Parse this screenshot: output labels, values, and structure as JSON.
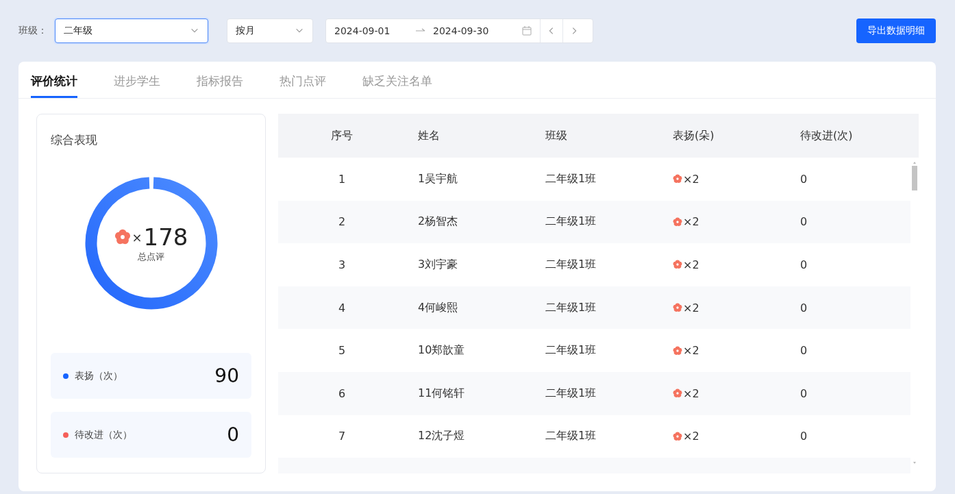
{
  "filters": {
    "class_label": "班级：",
    "class_value": "二年级",
    "period_value": "按月",
    "date_start": "2024-09-01",
    "date_end": "2024-09-30"
  },
  "export_button": "导出数据明细",
  "tabs": [
    {
      "label": "评价统计",
      "selected": true
    },
    {
      "label": "进步学生",
      "selected": false
    },
    {
      "label": "指标报告",
      "selected": false
    },
    {
      "label": "热门点评",
      "selected": false
    },
    {
      "label": "缺乏关注名单",
      "selected": false
    }
  ],
  "summary": {
    "title": "综合表现",
    "total_mark": "×",
    "total_value": "178",
    "total_label": "总点评",
    "stats": [
      {
        "label": "表扬（次）",
        "value": "90",
        "color": "#1664ff"
      },
      {
        "label": "待改进（次）",
        "value": "0",
        "color": "#f5605a"
      }
    ]
  },
  "table": {
    "columns": [
      "序号",
      "姓名",
      "班级",
      "表扬(朵)",
      "待改进(次)"
    ],
    "rows": [
      {
        "index": "1",
        "name": "1吴宇航",
        "class": "二年级1班",
        "praise": "×2",
        "improve": "0"
      },
      {
        "index": "2",
        "name": "2杨智杰",
        "class": "二年级1班",
        "praise": "×2",
        "improve": "0"
      },
      {
        "index": "3",
        "name": "3刘宇豪",
        "class": "二年级1班",
        "praise": "×2",
        "improve": "0"
      },
      {
        "index": "4",
        "name": "4何峻熙",
        "class": "二年级1班",
        "praise": "×2",
        "improve": "0"
      },
      {
        "index": "5",
        "name": "10郑歆童",
        "class": "二年级1班",
        "praise": "×2",
        "improve": "0"
      },
      {
        "index": "6",
        "name": "11何铭轩",
        "class": "二年级1班",
        "praise": "×2",
        "improve": "0"
      },
      {
        "index": "7",
        "name": "12沈子煜",
        "class": "二年级1班",
        "praise": "×2",
        "improve": "0"
      }
    ]
  }
}
